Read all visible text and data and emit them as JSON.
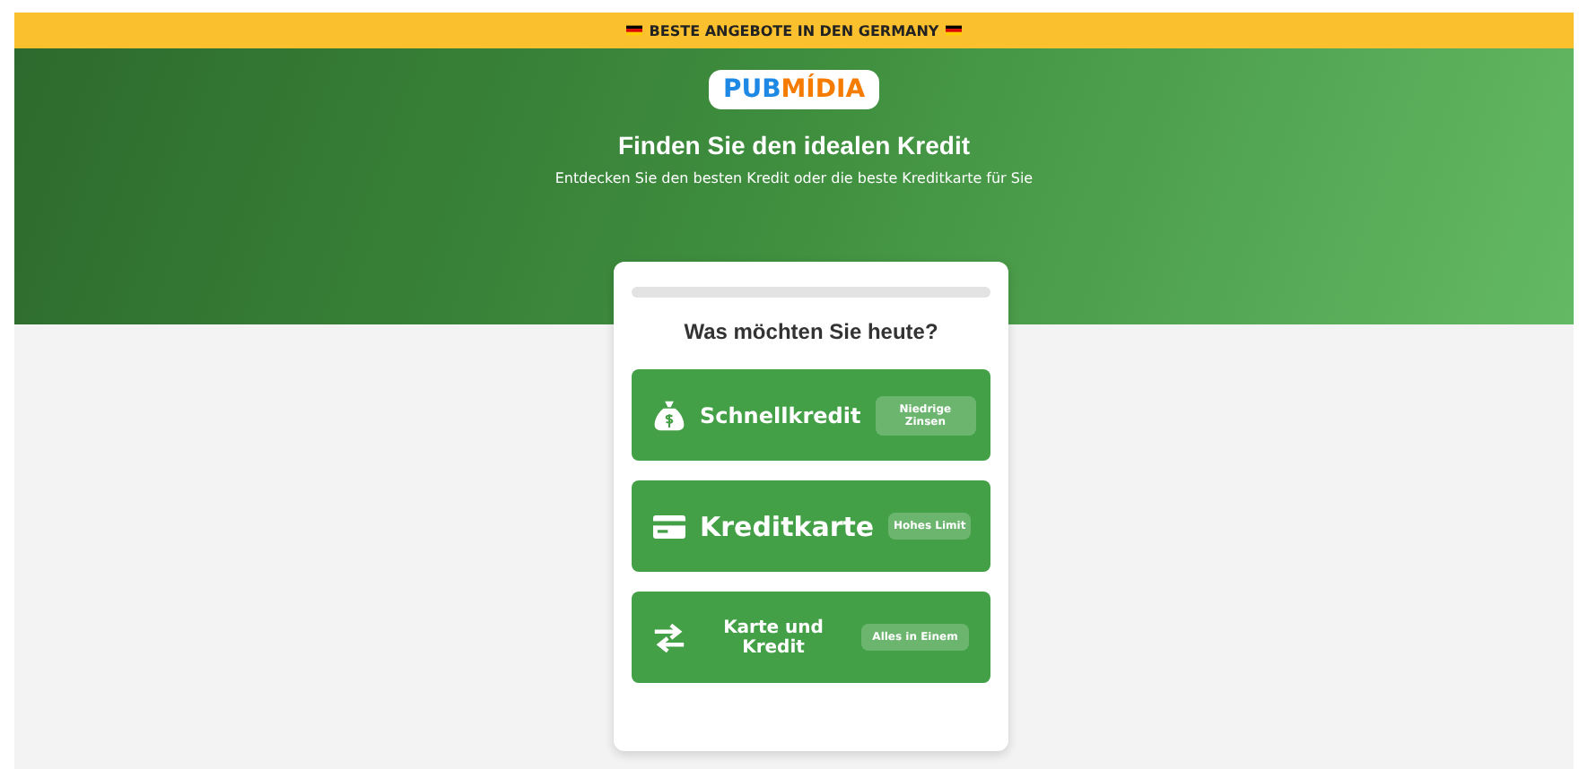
{
  "banner": {
    "text": "BESTE ANGEBOTE IN DEN GERMANY"
  },
  "logo": {
    "first": "PUB",
    "second": "MÍDIA"
  },
  "hero": {
    "title": "Finden Sie den idealen Kredit",
    "subtitle": "Entdecken Sie den besten Kredit oder die beste Kreditkarte für Sie"
  },
  "quiz": {
    "progress": {
      "level": 0
    },
    "question": "Was möchten Sie heute?",
    "options": [
      {
        "kind": "loan",
        "label": "Schnellkredit",
        "badge": "Niedrige Zinsen"
      },
      {
        "kind": "card",
        "label": "Kreditkarte",
        "badge": "Hohes Limit"
      },
      {
        "kind": "combo",
        "label": "Karte und Kredit",
        "badge": "Alles in Einem"
      }
    ]
  }
}
